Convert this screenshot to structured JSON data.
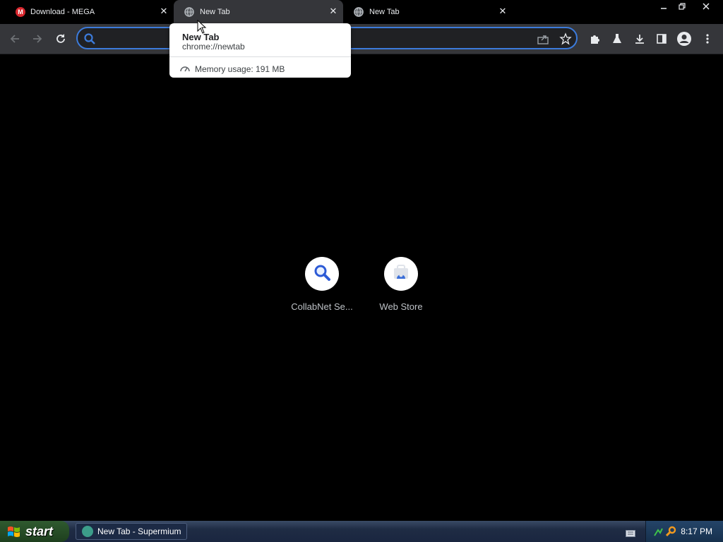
{
  "tabs": [
    {
      "label": "Download - MEGA",
      "icon": "mega-icon",
      "active": false
    },
    {
      "label": "New Tab",
      "icon": "globe-icon",
      "active": true
    },
    {
      "label": "New Tab",
      "icon": "globe-icon",
      "active": false
    }
  ],
  "window_controls": {
    "minimize": "minimize-icon",
    "restore": "restore-icon",
    "close": "close-icon"
  },
  "toolbar": {
    "omnibox_value": "",
    "omnibox_placeholder": ""
  },
  "hovercard": {
    "title": "New Tab",
    "url": "chrome://newtab",
    "memory": "Memory usage: 191 MB"
  },
  "shortcuts": [
    {
      "label": "CollabNet Se...",
      "icon": "search-icon"
    },
    {
      "label": "Web Store",
      "icon": "web-store-icon"
    }
  ],
  "taskbar": {
    "start_label": "start",
    "task_label": "New Tab - Supermium",
    "clock": "8:17 PM"
  },
  "colors": {
    "accent": "#3c7bdb",
    "toolbar": "#35363a",
    "page_bg": "#000000",
    "mega_red": "#d9272e"
  }
}
